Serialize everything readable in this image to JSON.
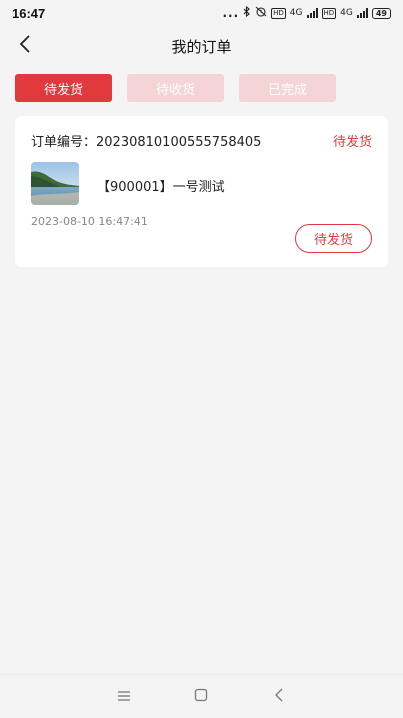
{
  "status_bar": {
    "time": "16:47",
    "dots": "...",
    "net1": "4G",
    "net2": "4G",
    "hd1": "HD",
    "hd2": "HD",
    "battery": "49"
  },
  "header": {
    "title": "我的订单"
  },
  "tabs": [
    {
      "label": "待发货",
      "active": true
    },
    {
      "label": "待收货",
      "active": false
    },
    {
      "label": "已完成",
      "active": false
    }
  ],
  "order": {
    "number_label": "订单编号：20230810100555758405",
    "status": "待发货",
    "product_name": "【900001】一号测试",
    "time": "2023-08-10 16:47:41",
    "action_label": "待发货"
  },
  "colors": {
    "accent": "#e03a3e",
    "accent_light": "#f4d4d5",
    "background": "#f4f4f4"
  }
}
